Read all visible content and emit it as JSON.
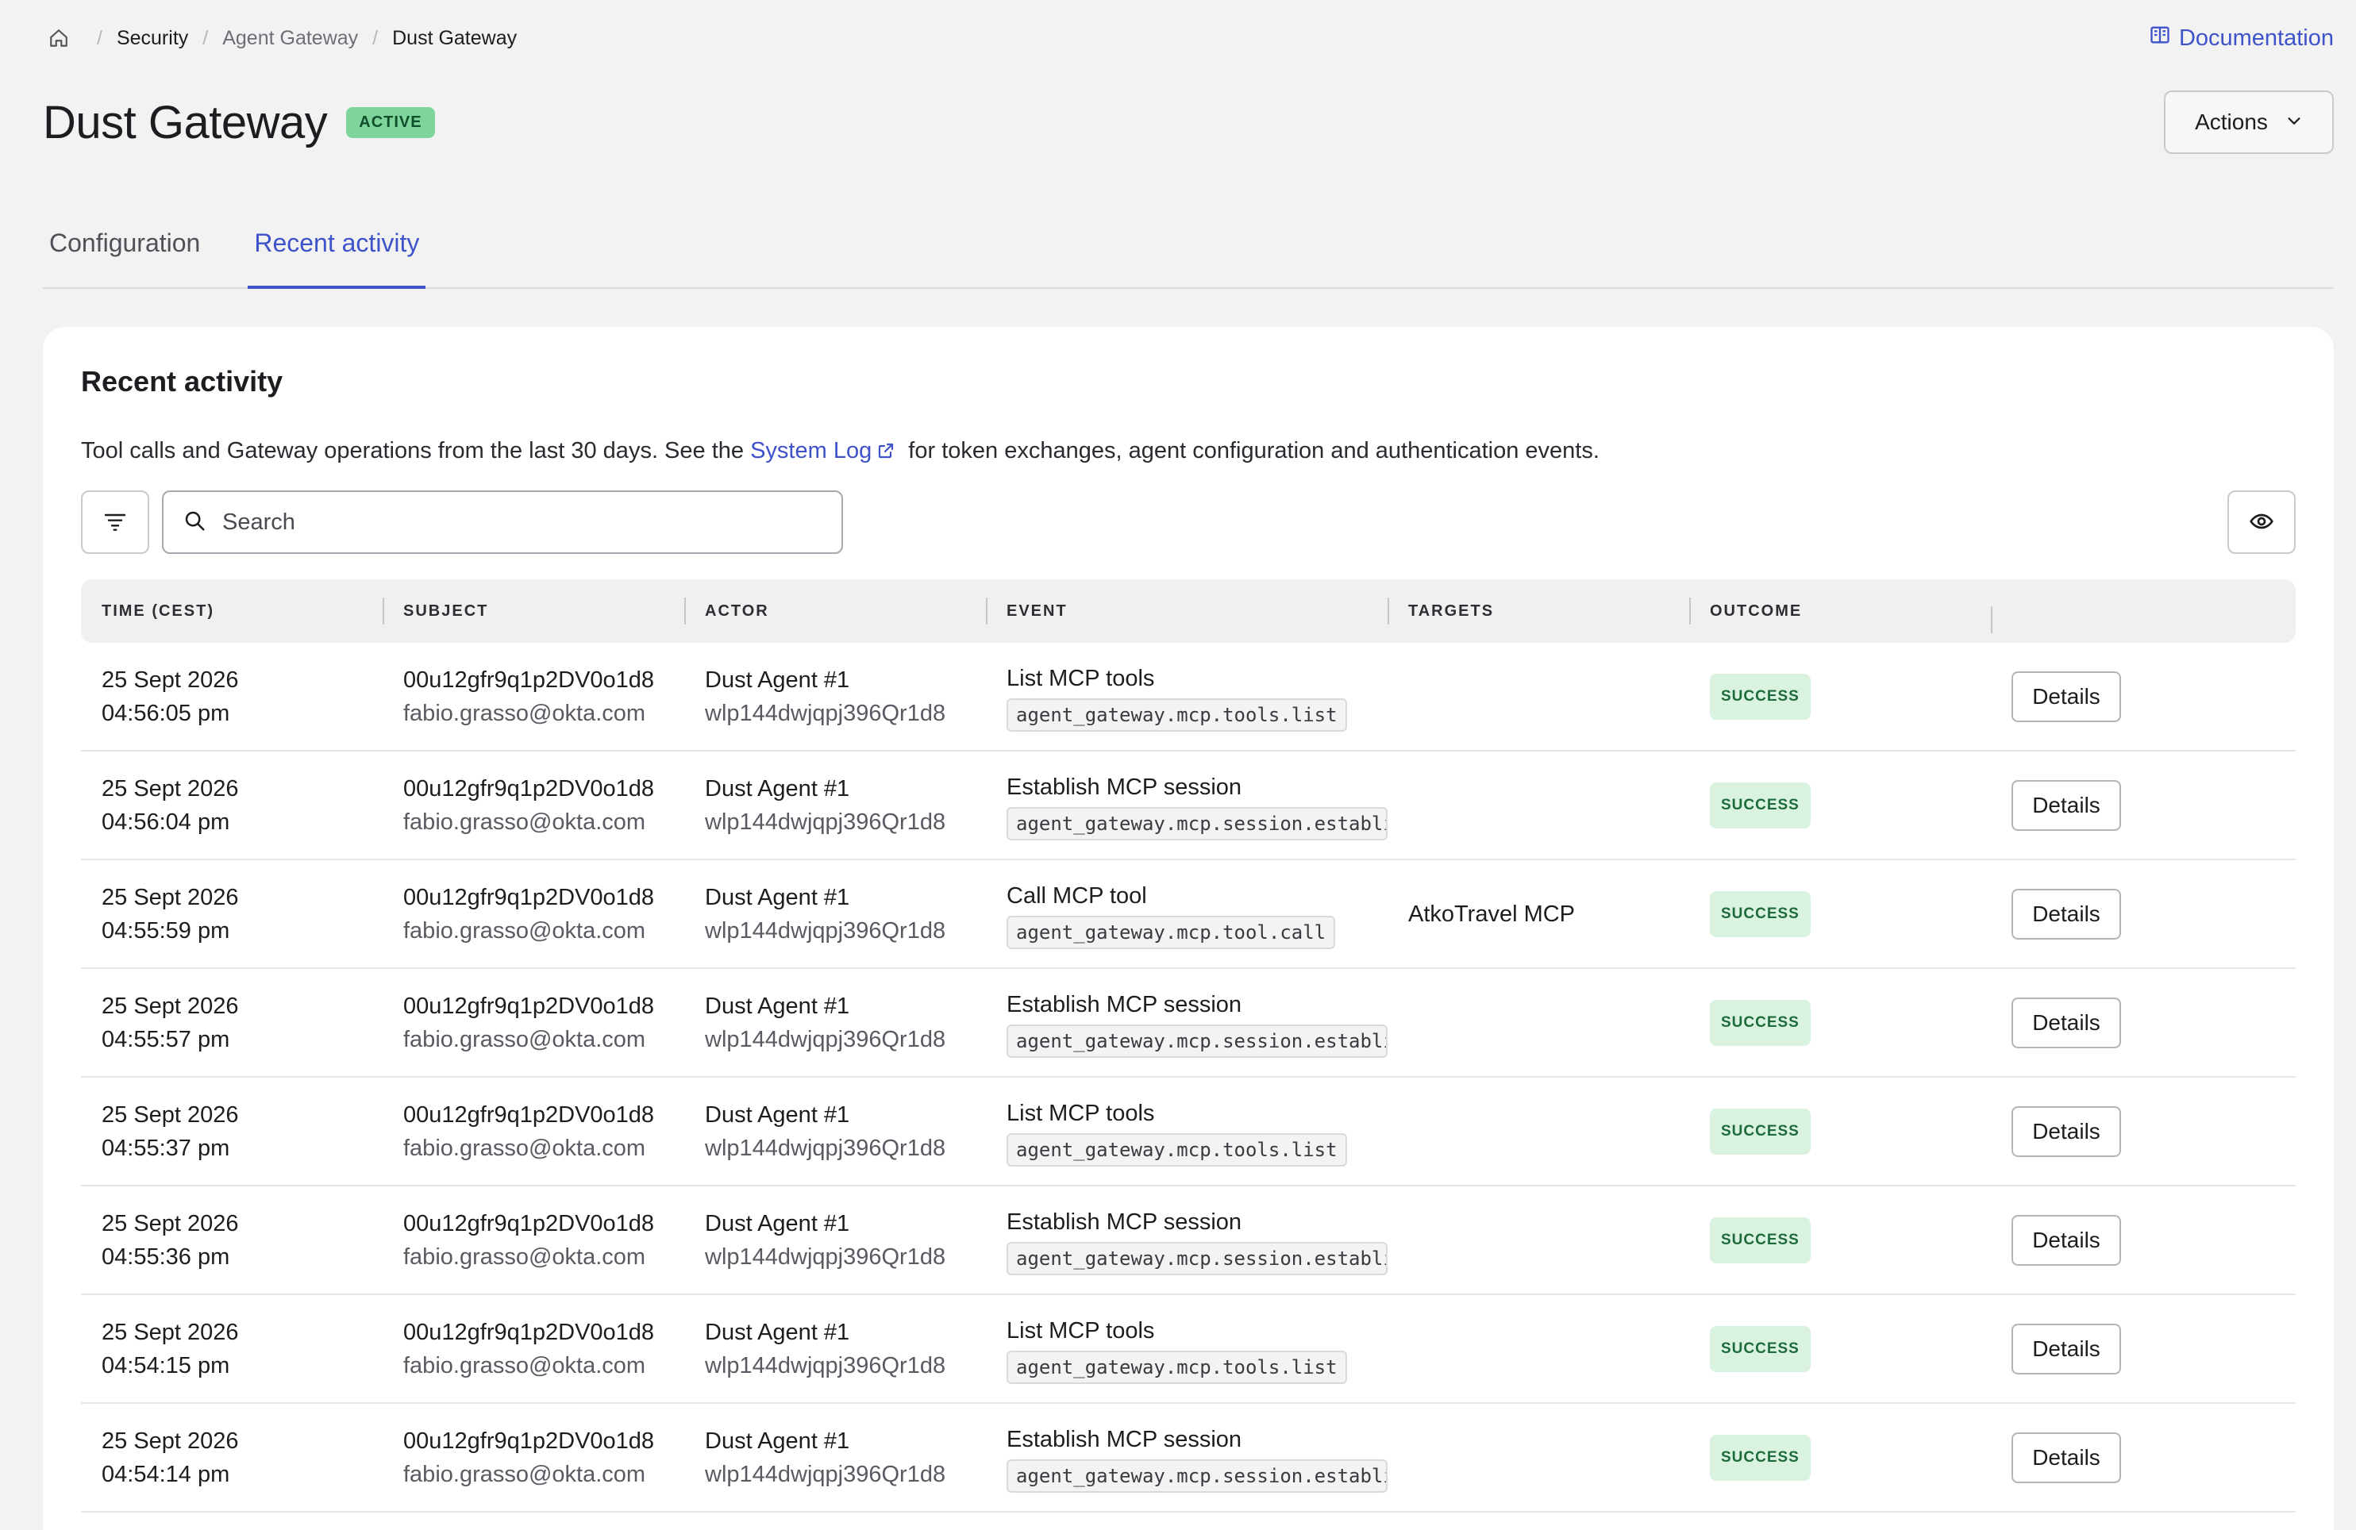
{
  "breadcrumb": {
    "items": [
      "Security",
      "Agent Gateway",
      "Dust Gateway"
    ]
  },
  "header": {
    "title": "Dust Gateway",
    "status": "ACTIVE",
    "documentation_label": "Documentation",
    "actions_label": "Actions"
  },
  "tabs": [
    {
      "label": "Configuration",
      "active": false
    },
    {
      "label": "Recent activity",
      "active": true
    }
  ],
  "activity": {
    "title": "Recent activity",
    "desc_before": "Tool calls and Gateway operations from the last 30 days. See the",
    "desc_link": "System Log",
    "desc_after": "for token exchanges, agent configuration and authentication events.",
    "search_placeholder": "Search",
    "columns": [
      "TIME (CEST)",
      "SUBJECT",
      "ACTOR",
      "EVENT",
      "TARGETS",
      "OUTCOME",
      ""
    ],
    "details_label": "Details",
    "rows": [
      {
        "date": "25 Sept 2026",
        "time": "04:56:05 pm",
        "subject_id": "00u12gfr9q1p2DV0o1d8",
        "subject_email": "fabio.grasso@okta.com",
        "actor": "Dust Agent #1",
        "actor_id": "wlp144dwjqpj396Qr1d8",
        "event": "List MCP tools",
        "event_code": "agent_gateway.mcp.tools.list",
        "target": "",
        "outcome": "SUCCESS"
      },
      {
        "date": "25 Sept 2026",
        "time": "04:56:04 pm",
        "subject_id": "00u12gfr9q1p2DV0o1d8",
        "subject_email": "fabio.grasso@okta.com",
        "actor": "Dust Agent #1",
        "actor_id": "wlp144dwjqpj396Qr1d8",
        "event": "Establish MCP session",
        "event_code": "agent_gateway.mcp.session.establi",
        "target": "",
        "outcome": "SUCCESS"
      },
      {
        "date": "25 Sept 2026",
        "time": "04:55:59 pm",
        "subject_id": "00u12gfr9q1p2DV0o1d8",
        "subject_email": "fabio.grasso@okta.com",
        "actor": "Dust Agent #1",
        "actor_id": "wlp144dwjqpj396Qr1d8",
        "event": "Call MCP tool",
        "event_code": "agent_gateway.mcp.tool.call",
        "target": "AtkoTravel MCP",
        "outcome": "SUCCESS"
      },
      {
        "date": "25 Sept 2026",
        "time": "04:55:57 pm",
        "subject_id": "00u12gfr9q1p2DV0o1d8",
        "subject_email": "fabio.grasso@okta.com",
        "actor": "Dust Agent #1",
        "actor_id": "wlp144dwjqpj396Qr1d8",
        "event": "Establish MCP session",
        "event_code": "agent_gateway.mcp.session.establi",
        "target": "",
        "outcome": "SUCCESS"
      },
      {
        "date": "25 Sept 2026",
        "time": "04:55:37 pm",
        "subject_id": "00u12gfr9q1p2DV0o1d8",
        "subject_email": "fabio.grasso@okta.com",
        "actor": "Dust Agent #1",
        "actor_id": "wlp144dwjqpj396Qr1d8",
        "event": "List MCP tools",
        "event_code": "agent_gateway.mcp.tools.list",
        "target": "",
        "outcome": "SUCCESS"
      },
      {
        "date": "25 Sept 2026",
        "time": "04:55:36 pm",
        "subject_id": "00u12gfr9q1p2DV0o1d8",
        "subject_email": "fabio.grasso@okta.com",
        "actor": "Dust Agent #1",
        "actor_id": "wlp144dwjqpj396Qr1d8",
        "event": "Establish MCP session",
        "event_code": "agent_gateway.mcp.session.establi",
        "target": "",
        "outcome": "SUCCESS"
      },
      {
        "date": "25 Sept 2026",
        "time": "04:54:15 pm",
        "subject_id": "00u12gfr9q1p2DV0o1d8",
        "subject_email": "fabio.grasso@okta.com",
        "actor": "Dust Agent #1",
        "actor_id": "wlp144dwjqpj396Qr1d8",
        "event": "List MCP tools",
        "event_code": "agent_gateway.mcp.tools.list",
        "target": "",
        "outcome": "SUCCESS"
      },
      {
        "date": "25 Sept 2026",
        "time": "04:54:14 pm",
        "subject_id": "00u12gfr9q1p2DV0o1d8",
        "subject_email": "fabio.grasso@okta.com",
        "actor": "Dust Agent #1",
        "actor_id": "wlp144dwjqpj396Qr1d8",
        "event": "Establish MCP session",
        "event_code": "agent_gateway.mcp.session.establi",
        "target": "",
        "outcome": "SUCCESS"
      }
    ]
  },
  "icons": {
    "home": "home-icon",
    "documentation": "book-icon",
    "actions": "chevron-down-icon",
    "filter": "filter-icon",
    "search": "search-icon",
    "columns": "eye-icon",
    "external": "external-link-icon"
  },
  "colors": {
    "accent": "#3e52c9",
    "status_active": "#7fd49b",
    "success_bg": "#daf3e1",
    "success_text": "#1d6b3b"
  }
}
